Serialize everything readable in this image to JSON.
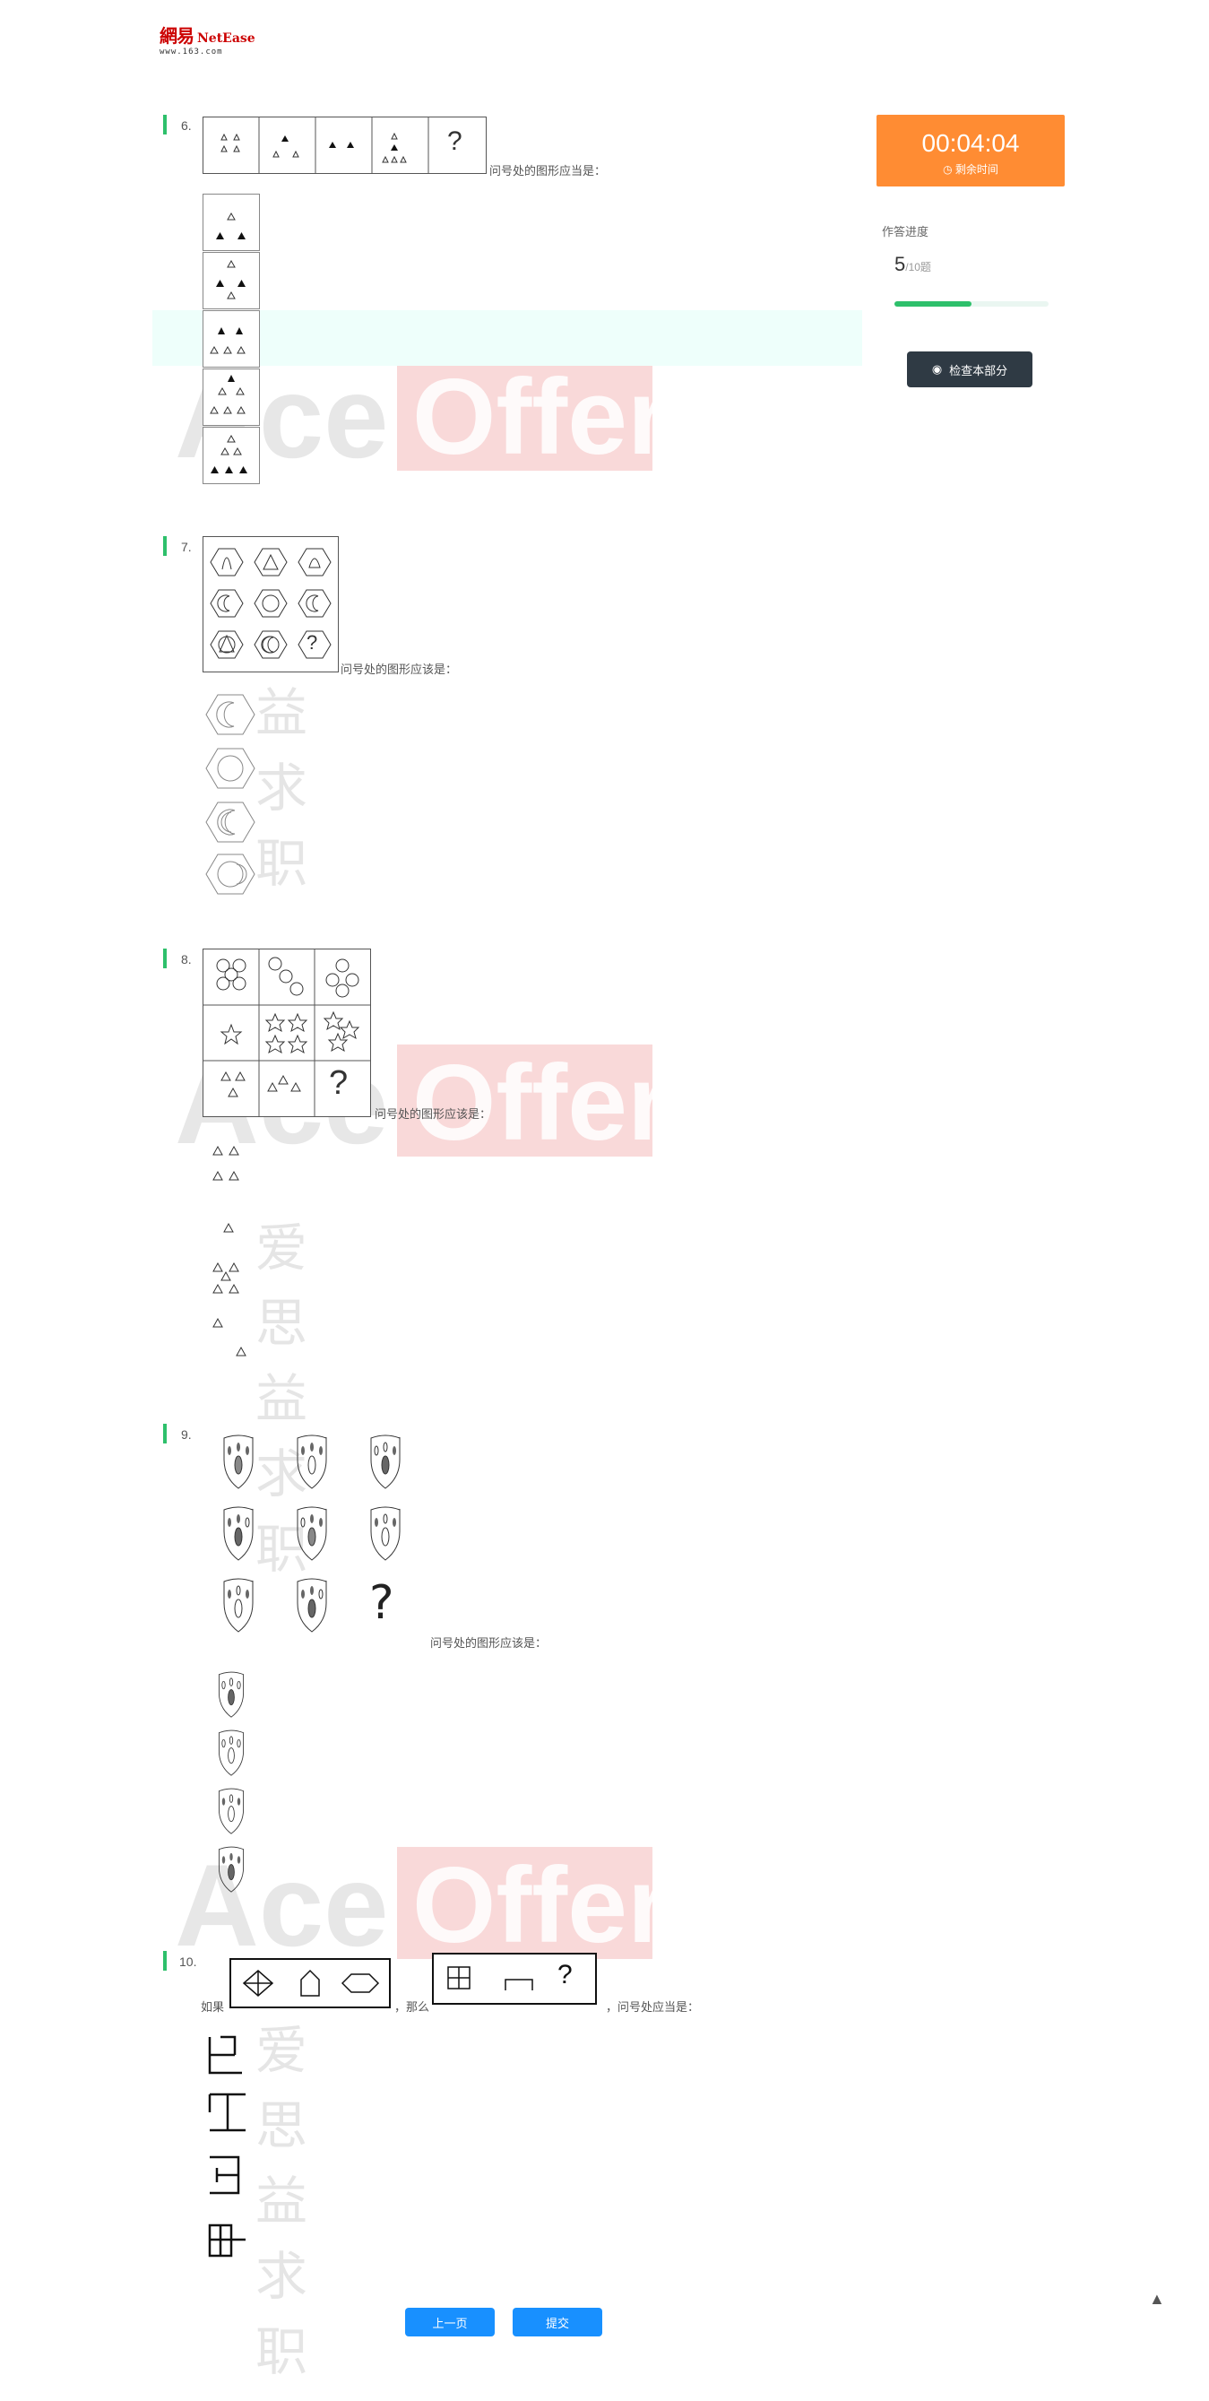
{
  "header": {
    "logo_cn": "網易",
    "logo_en": "NetEase",
    "logo_url": "www.163.com"
  },
  "timer": {
    "time": "00:04:04",
    "label": "剩余时间"
  },
  "progress": {
    "label": "作答进度",
    "done": "5",
    "total": "/10题",
    "fraction": 0.5
  },
  "check_button": "检查本部分",
  "questions": [
    {
      "number": "6.",
      "prompt": "问号处的图形应当是："
    },
    {
      "number": "7.",
      "prompt": "问号处的图形应该是："
    },
    {
      "number": "8.",
      "prompt": "问号处的图形应该是："
    },
    {
      "number": "9.",
      "prompt": "问号处的图形应该是："
    },
    {
      "number": "10.",
      "prompt_if": "如果",
      "prompt_then": "，那么",
      "prompt_end": "，问号处应当是："
    }
  ],
  "question_mark": "?",
  "nav": {
    "prev": "上一页",
    "submit": "提交"
  },
  "watermark": {
    "ace": "Ace",
    "offer": "Offer",
    "cn": "爱思益求职"
  },
  "colors": {
    "accent_green": "#2ec06b",
    "timer_orange": "#ff8c33",
    "button_blue": "#1890ff",
    "dark_button": "#2f3a44"
  }
}
